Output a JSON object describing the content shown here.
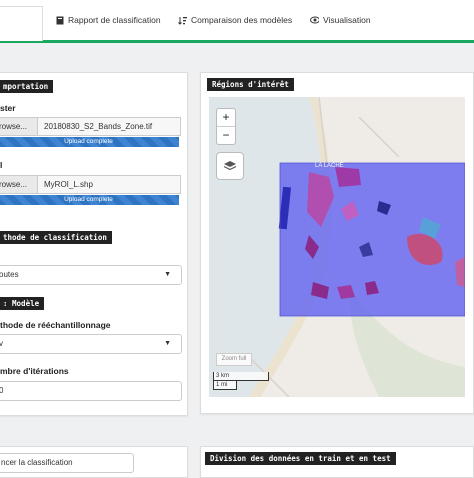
{
  "tabs": [
    {
      "label": "Rapport de classification",
      "icon": "book-icon"
    },
    {
      "label": "Comparaison des modèles",
      "icon": "sort-icon"
    },
    {
      "label": "Visualisation",
      "icon": "eye-icon"
    }
  ],
  "left": {
    "import_header": "mportation",
    "raster_label": "ster",
    "raster_browse": "rowse...",
    "raster_file": "20180830_S2_Bands_Zone.tif",
    "raster_progress": "Upload complete",
    "vector_label": "l",
    "vector_browse": "rowse...",
    "vector_file": "MyROI_L.shp",
    "vector_progress": "Upload complete",
    "method_header": "thode de classification",
    "method_value": "outes",
    "model_header": "Modèle",
    "resampling_label": "thode de rééchantillonnage",
    "resampling_value": "v",
    "iterations_label": "mbre d'itérations",
    "iterations_value": "0"
  },
  "right": {
    "roi_header": "Régions d'intérêt",
    "map_place": "LA LACHE",
    "zoom_full": "Zoom full",
    "scale_km": "3 km",
    "scale_mi": "1 mi"
  },
  "bottom": {
    "run_button": "ncer la classification",
    "split_header": "Division des données en train et en test"
  },
  "colors": {
    "accent": "#18a860",
    "roi": "#6a6af0",
    "progress": "#2f74c0"
  }
}
